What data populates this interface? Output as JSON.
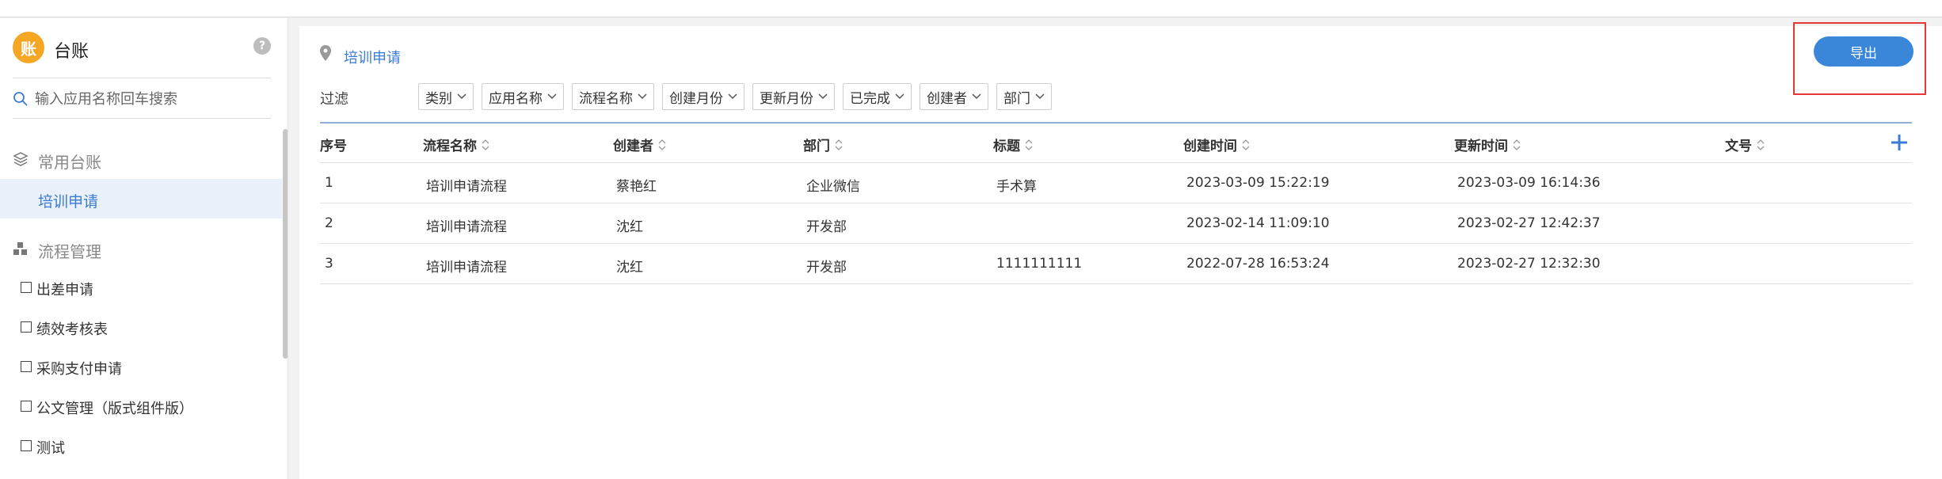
{
  "sidebar": {
    "logo_char": "账",
    "title": "台账",
    "help": "?",
    "search_placeholder": "输入应用名称回车搜索",
    "sections": [
      {
        "label": "常用台账",
        "icon": "layers-icon"
      },
      {
        "label": "流程管理",
        "icon": "blocks-icon"
      }
    ],
    "active_item": "培训申请",
    "items": [
      "出差申请",
      "绩效考核表",
      "采购支付申请",
      "公文管理（版式组件版）",
      "测试"
    ]
  },
  "main": {
    "breadcrumb": "培训申请",
    "export_label": "导出",
    "filter_label": "过滤",
    "filters": [
      "类别",
      "应用名称",
      "流程名称",
      "创建月份",
      "更新月份",
      "已完成",
      "创建者",
      "部门"
    ],
    "columns": [
      "序号",
      "流程名称",
      "创建者",
      "部门",
      "标题",
      "创建时间",
      "更新时间",
      "文号"
    ],
    "rows": [
      [
        "1",
        "培训申请流程",
        "蔡艳红",
        "企业微信",
        "手术算",
        "2023-03-09 15:22:19",
        "2023-03-09 16:14:36",
        ""
      ],
      [
        "2",
        "培训申请流程",
        "沈红",
        "开发部",
        "",
        "2023-02-14 11:09:10",
        "2023-02-27 12:42:37",
        ""
      ],
      [
        "3",
        "培训申请流程",
        "沈红",
        "开发部",
        "1111111111",
        "2022-07-28 16:53:24",
        "2023-02-27 12:32:30",
        ""
      ]
    ]
  },
  "colors": {
    "accent": "#3a7bd5",
    "button": "#3a86d8",
    "logo": "#f5a623",
    "highlight": "#e53935",
    "active_bg": "#eaf1fb"
  }
}
